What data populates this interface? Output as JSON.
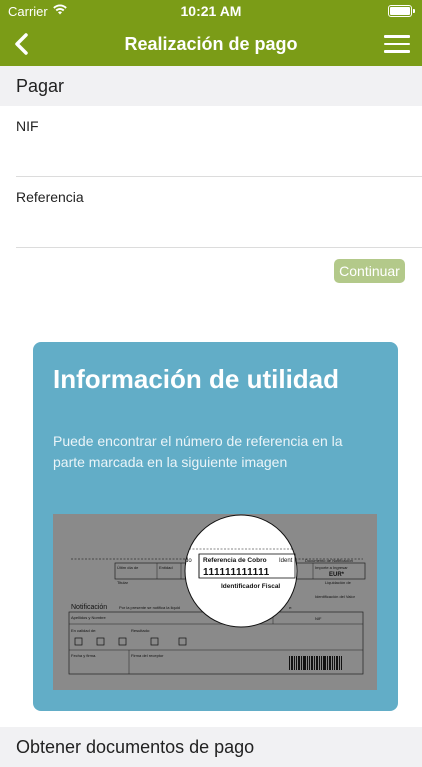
{
  "status_bar": {
    "carrier": "Carrier",
    "time": "10:21 AM"
  },
  "nav": {
    "title": "Realización de pago",
    "back_icon": "chevron-left-icon",
    "menu_icon": "hamburger-menu-icon",
    "color": "#7b9c17"
  },
  "form": {
    "section_title": "Pagar",
    "fields": [
      {
        "label": "NIF",
        "value": ""
      },
      {
        "label": "Referencia",
        "value": ""
      }
    ],
    "continue_label": "Continuar"
  },
  "info": {
    "title": "Información de utilidad",
    "description": "Puede encontrar el número de referencia en la parte marcada en la siguiente imagen",
    "card_color": "#62adc7",
    "image": {
      "reference_label": "Referencia de Cobro",
      "reference_number": "111111111111",
      "fiscal_label": "Identificador Fiscal",
      "col_ultim": "Últim día de",
      "col_entidad": "Entidad",
      "col_titular": "Titular",
      "col_notificacion": "Documento de Notificación",
      "col_importe": "Importe a Ingresar",
      "currency": "EUR*",
      "liquidacion": "Liquidación de",
      "identificacion_valor": "Identificación del Valor",
      "notificacion": "Notificación",
      "notif_text": "Por la presente se notifica la liquid",
      "apellidos": "Apellidos y Nombre",
      "nif": "NIF",
      "calidad": "En calidad de:",
      "resultado": "Resultado:",
      "fecha": "Fecha y firma.",
      "firma_receptor": "Firma del receptor"
    }
  },
  "bottom": {
    "section_title": "Obtener documentos de pago"
  }
}
